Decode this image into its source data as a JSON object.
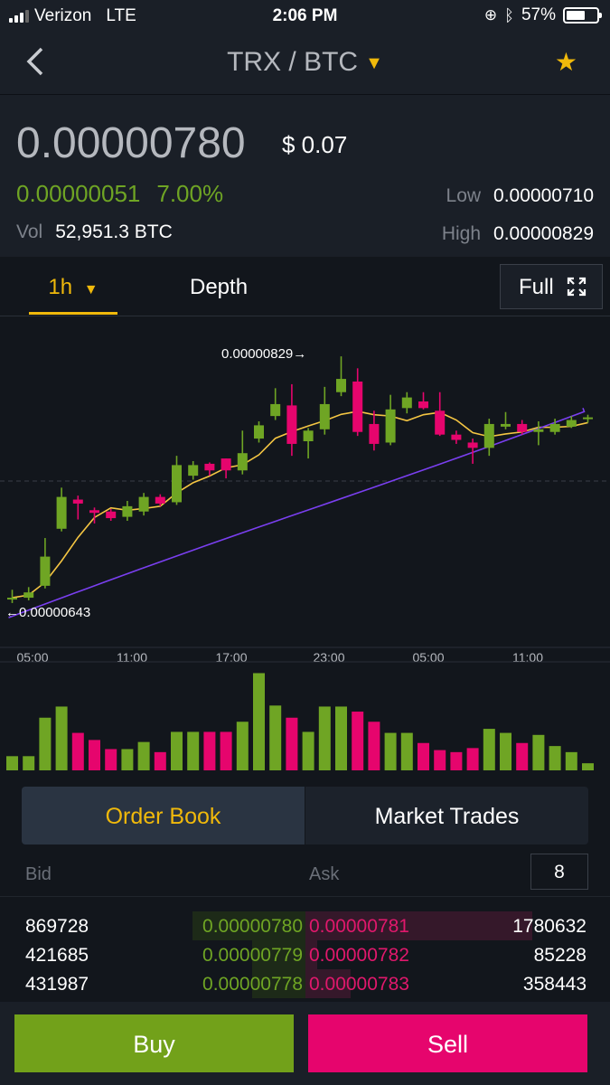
{
  "status_bar": {
    "carrier": "Verizon",
    "network": "LTE",
    "time": "2:06 PM",
    "battery": "57%"
  },
  "nav": {
    "back_icon": "chevron-left-icon",
    "pair": "TRX / BTC",
    "star_icon": "star-icon"
  },
  "ticker": {
    "last_price": "0.00000780",
    "usd_price": "$ 0.07",
    "change": "0.00000051",
    "change_pct": "7.00%",
    "low_label": "Low",
    "low": "0.00000710",
    "high_label": "High",
    "high": "0.00000829",
    "vol_label": "Vol",
    "vol": "52,951.3 BTC"
  },
  "chart_tabs": {
    "interval": "1h",
    "depth": "Depth",
    "full": "Full"
  },
  "colors": {
    "up": "#6fa524",
    "down": "#e6056d",
    "accent": "#f0b90b",
    "ma7": "#f5c643",
    "ma25": "#7a3ff0"
  },
  "chart_data": {
    "type": "candlestick",
    "x_ticks": [
      "05:00",
      "11:00",
      "17:00",
      "23:00",
      "05:00",
      "11:00"
    ],
    "high_annotation": "0.00000829",
    "low_annotation": "0.00000643",
    "ylim": [
      6.3e-06,
      8.4e-06
    ],
    "candles": [
      {
        "o": 6.47,
        "c": 6.47,
        "h": 6.53,
        "l": 6.43
      },
      {
        "o": 6.47,
        "c": 6.51,
        "h": 6.55,
        "l": 6.45
      },
      {
        "o": 6.56,
        "c": 6.78,
        "h": 6.92,
        "l": 6.54
      },
      {
        "o": 6.99,
        "c": 7.23,
        "h": 7.3,
        "l": 6.97
      },
      {
        "o": 7.21,
        "c": 7.18,
        "h": 7.24,
        "l": 7.06
      },
      {
        "o": 7.13,
        "c": 7.11,
        "h": 7.15,
        "l": 7.03
      },
      {
        "o": 7.12,
        "c": 7.07,
        "h": 7.14,
        "l": 7.05
      },
      {
        "o": 7.08,
        "c": 7.16,
        "h": 7.2,
        "l": 7.05
      },
      {
        "o": 7.12,
        "c": 7.23,
        "h": 7.26,
        "l": 7.09
      },
      {
        "o": 7.23,
        "c": 7.18,
        "h": 7.25,
        "l": 7.16
      },
      {
        "o": 7.19,
        "c": 7.47,
        "h": 7.54,
        "l": 7.17
      },
      {
        "o": 7.39,
        "c": 7.47,
        "h": 7.5,
        "l": 7.36
      },
      {
        "o": 7.48,
        "c": 7.43,
        "h": 7.49,
        "l": 7.39
      },
      {
        "o": 7.52,
        "c": 7.43,
        "h": 7.52,
        "l": 7.37
      },
      {
        "o": 7.43,
        "c": 7.56,
        "h": 7.73,
        "l": 7.4
      },
      {
        "o": 7.67,
        "c": 7.77,
        "h": 7.8,
        "l": 7.64
      },
      {
        "o": 7.84,
        "c": 7.93,
        "h": 8.05,
        "l": 7.81
      },
      {
        "o": 7.92,
        "c": 7.63,
        "h": 8.08,
        "l": 7.54
      },
      {
        "o": 7.65,
        "c": 7.73,
        "h": 7.75,
        "l": 7.52
      },
      {
        "o": 7.74,
        "c": 7.93,
        "h": 8.06,
        "l": 7.7
      },
      {
        "o": 8.02,
        "c": 8.12,
        "h": 8.29,
        "l": 7.99
      },
      {
        "o": 8.1,
        "c": 7.72,
        "h": 8.2,
        "l": 7.69
      },
      {
        "o": 7.78,
        "c": 7.63,
        "h": 7.88,
        "l": 7.58
      },
      {
        "o": 7.64,
        "c": 7.89,
        "h": 8.0,
        "l": 7.62
      },
      {
        "o": 7.9,
        "c": 7.98,
        "h": 8.02,
        "l": 7.86
      },
      {
        "o": 7.95,
        "c": 7.9,
        "h": 8.02,
        "l": 7.89
      },
      {
        "o": 7.88,
        "c": 7.7,
        "h": 8.02,
        "l": 7.69
      },
      {
        "o": 7.7,
        "c": 7.66,
        "h": 7.73,
        "l": 7.63
      },
      {
        "o": 7.64,
        "c": 7.6,
        "h": 7.67,
        "l": 7.48
      },
      {
        "o": 7.6,
        "c": 7.78,
        "h": 7.82,
        "l": 7.54
      },
      {
        "o": 7.76,
        "c": 7.78,
        "h": 7.87,
        "l": 7.74
      },
      {
        "o": 7.78,
        "c": 7.72,
        "h": 7.81,
        "l": 7.7
      },
      {
        "o": 7.72,
        "c": 7.74,
        "h": 7.8,
        "l": 7.62
      },
      {
        "o": 7.72,
        "c": 7.78,
        "h": 7.82,
        "l": 7.7
      },
      {
        "o": 7.76,
        "c": 7.81,
        "h": 7.84,
        "l": 7.75
      },
      {
        "o": 7.82,
        "c": 7.83,
        "h": 7.85,
        "l": 7.79
      }
    ],
    "volumes": [
      0.14,
      0.14,
      0.52,
      0.63,
      0.37,
      0.3,
      0.21,
      0.21,
      0.28,
      0.18,
      0.38,
      0.38,
      0.38,
      0.38,
      0.48,
      0.96,
      0.64,
      0.52,
      0.38,
      0.63,
      0.63,
      0.58,
      0.48,
      0.37,
      0.37,
      0.27,
      0.2,
      0.18,
      0.22,
      0.41,
      0.37,
      0.27,
      0.35,
      0.24,
      0.18,
      0.07
    ]
  },
  "order_book": {
    "tab_active": "Order Book",
    "tab_inactive": "Market Trades",
    "bid_label": "Bid",
    "ask_label": "Ask",
    "depth_value": "8",
    "rows": [
      {
        "bid_qty": "869728",
        "bid_price": "0.00000780",
        "ask_price": "0.00000781",
        "ask_qty": "1780632",
        "bid_depth": 0.38,
        "ask_depth": 0.76
      },
      {
        "bid_qty": "421685",
        "bid_price": "0.00000779",
        "ask_price": "0.00000782",
        "ask_qty": "85228",
        "bid_depth": 0.18,
        "ask_depth": 0.04
      },
      {
        "bid_qty": "431987",
        "bid_price": "0.00000778",
        "ask_price": "0.00000783",
        "ask_qty": "358443",
        "bid_depth": 0.18,
        "ask_depth": 0.15
      }
    ]
  },
  "actions": {
    "buy": "Buy",
    "sell": "Sell"
  }
}
